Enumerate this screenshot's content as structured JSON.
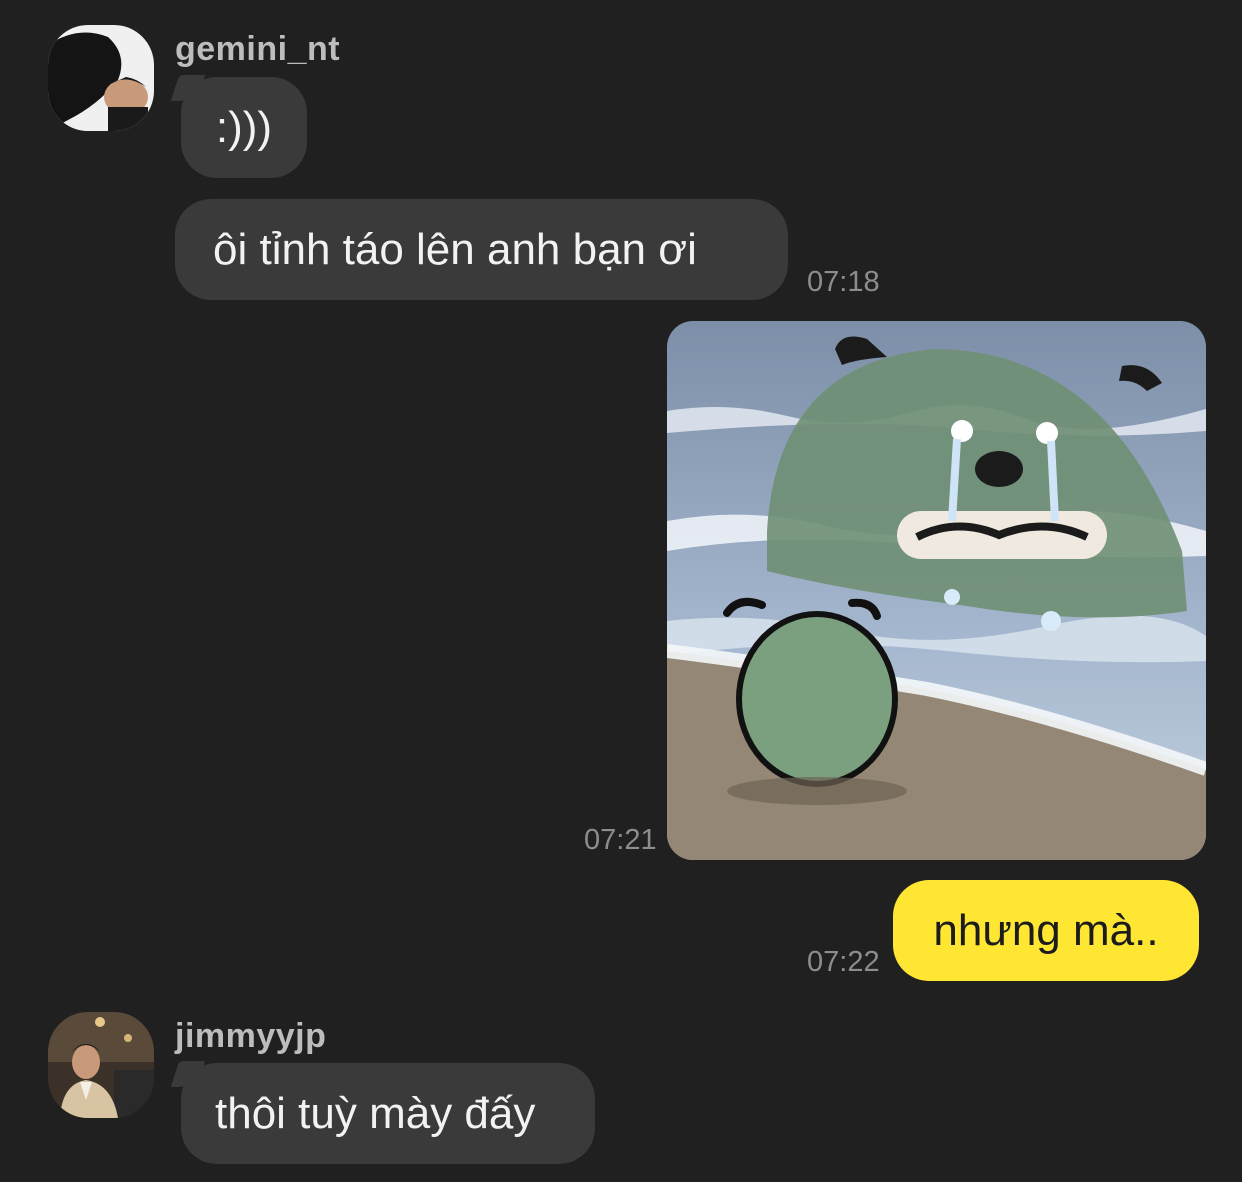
{
  "messages": [
    {
      "sender": "gemini_nt",
      "avatar_icon": "avatar-photo-icon",
      "bubbles": [
        ":)))",
        "ôi tỉnh táo lên anh bạn ơi"
      ],
      "time": "07:18"
    },
    {
      "sender": "me",
      "sticker_icon": "crying-green-blob-sticker-icon",
      "time": "07:21"
    },
    {
      "sender": "me",
      "text": "nhưng mà..",
      "time": "07:22"
    },
    {
      "sender": "jimmyyjp",
      "avatar_icon": "avatar-photo-icon",
      "bubbles": [
        "thôi tuỳ mày đấy"
      ]
    }
  ],
  "colors": {
    "background": "#202020",
    "incoming_bubble": "#3a3a3a",
    "outgoing_bubble": "#ffe633",
    "timestamp": "#8d8d8d",
    "sender_name": "#bdbdbd"
  }
}
